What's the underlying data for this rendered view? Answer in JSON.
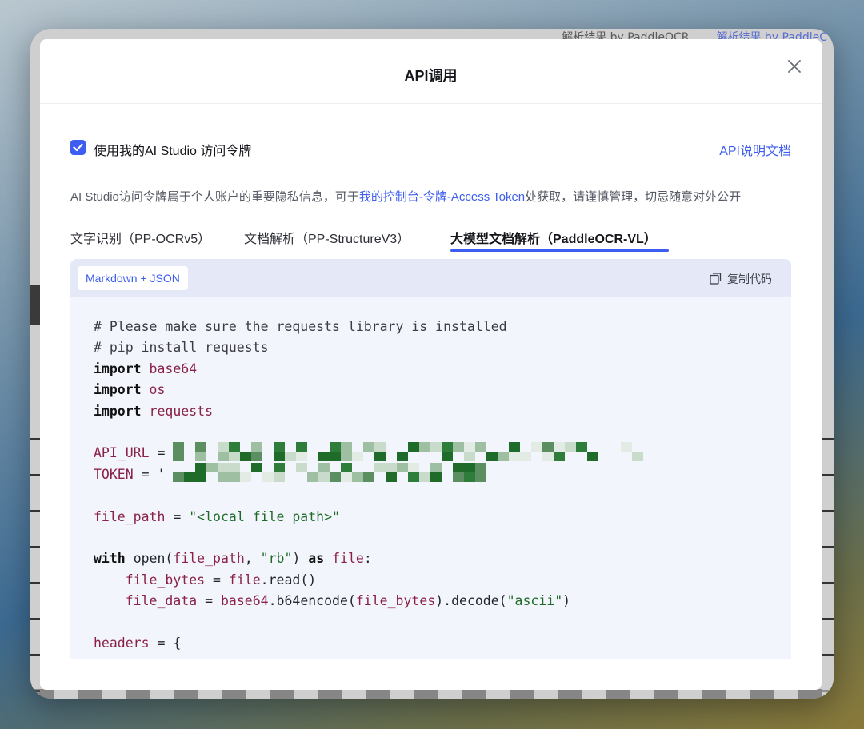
{
  "background": {
    "tab_left": "解析结果 by PaddleOCR",
    "tab_right": "解析结果 by PaddleC"
  },
  "modal": {
    "title": "API调用",
    "close_icon": "close-icon"
  },
  "token": {
    "checked": true,
    "label": "使用我的AI Studio 访问令牌",
    "doc_link": "API说明文档"
  },
  "notice": {
    "prefix": "AI Studio访问令牌属于个人账户的重要隐私信息，可于",
    "link": "我的控制台-令牌-Access Token",
    "suffix": "处获取，请谨慎管理，切忌随意对外公开"
  },
  "tabs": [
    {
      "label": "文字识别（PP-OCRv5）",
      "active": false
    },
    {
      "label": "文档解析（PP-StructureV3）",
      "active": false
    },
    {
      "label": "大模型文档解析（PaddleOCR-VL）",
      "active": true
    }
  ],
  "code_panel": {
    "language_tag": "Markdown + JSON",
    "copy_label": "复制代码",
    "copy_icon": "copy-icon"
  },
  "code": {
    "comment1": "# Please make sure the requests library is installed",
    "comment2": "# pip install requests",
    "kw_import": "import",
    "mod_base64": "base64",
    "mod_os": "os",
    "mod_requests": "requests",
    "api_url_var": "API_URL",
    "token_var": "TOKEN",
    "file_path_var": "file_path",
    "file_path_value": "\"<local file path>\"",
    "kw_with": "with",
    "open_call": "open(",
    "rb": "\"rb\"",
    "kw_as": "as",
    "file_var": "file",
    "file_bytes_var": "file_bytes",
    "read_call": ".read()",
    "file_data_var": "file_data",
    "base64_mod": "base64",
    "encode_call": ".b64encode(",
    "decode_call": ").decode(",
    "ascii": "\"ascii\"",
    "headers_var": "headers",
    "headers_open": " = {"
  },
  "colors": {
    "accent": "#3d5ef0",
    "code_var": "#8a2247",
    "code_string": "#1d6b26"
  }
}
